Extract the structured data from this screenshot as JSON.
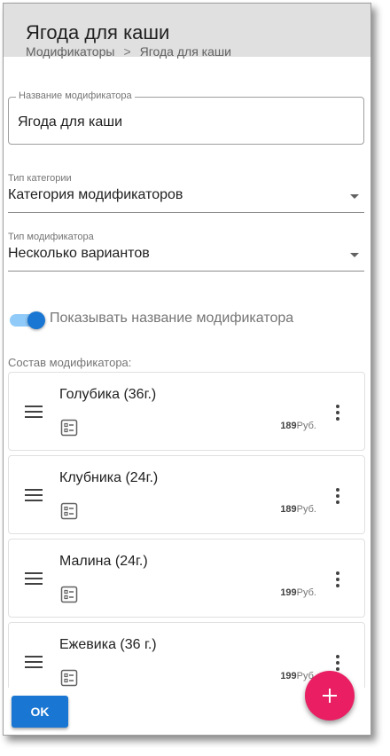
{
  "header": {
    "title": "Ягода для каши",
    "breadcrumb": {
      "parent": "Модификаторы",
      "separator": ">",
      "current": "Ягода для каши"
    }
  },
  "form": {
    "name_field": {
      "label": "Название модификатора",
      "value": "Ягода для каши"
    },
    "category_type": {
      "label": "Тип категории",
      "value": "Категория модификаторов"
    },
    "modifier_type": {
      "label": "Тип модификатора",
      "value": "Несколько вариантов"
    },
    "show_name_toggle": {
      "label": "Показывать название модификатора",
      "checked": true
    },
    "composition_label": "Состав модификатора:"
  },
  "items": [
    {
      "name": "Голубика (36г.)",
      "price": "189",
      "currency": "Руб."
    },
    {
      "name": "Клубника (24г.)",
      "price": "189",
      "currency": "Руб."
    },
    {
      "name": "Малина (24г.)",
      "price": "199",
      "currency": "Руб."
    },
    {
      "name": "Ежевика (36 г.)",
      "price": "199",
      "currency": "Руб."
    }
  ],
  "actions": {
    "ok_label": "OK",
    "add_icon": "plus-icon"
  },
  "colors": {
    "primary": "#1976d2",
    "accent": "#e91e63",
    "header_bg": "#e0e0e0"
  }
}
